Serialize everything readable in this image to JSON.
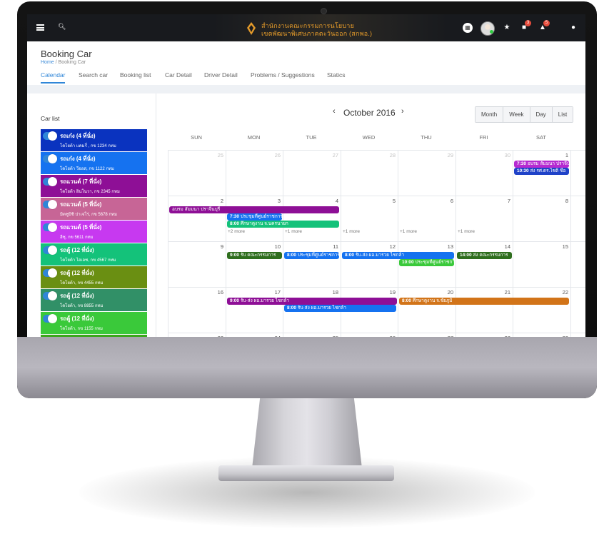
{
  "topbar": {
    "logo_line1": "สำนักงานคณะกรรมการนโยบาย",
    "logo_line2": "เขตพัฒนาพิเศษภาคตะวันออก (สกพอ.)",
    "badge_messages": "3",
    "badge_notifications": "5"
  },
  "header": {
    "title": "Booking Car",
    "breadcrumb_home": "Home",
    "breadcrumb_sep": "/",
    "breadcrumb_current": "Booking Car"
  },
  "tabs": [
    "Calendar",
    "Search car",
    "Booking list",
    "Car Detail",
    "Driver Detail",
    "Problems / Suggestions",
    "Statics"
  ],
  "sidebar": {
    "title": "Car list",
    "cars": [
      {
        "name": "รถเก๋ง (4 ที่นั่ง)",
        "detail": "โตโยต้า แคมรี่ , กข 1234 กทม",
        "color": "#0a33bf"
      },
      {
        "name": "รถเก๋ง (4 ที่นั่ง)",
        "detail": "โตโยต้า วีออส, กข 1122 กทม",
        "color": "#1572f0"
      },
      {
        "name": "รถแวนด์ (7 ที่นั่ง)",
        "detail": "โตโยต้า อินโนวา, กข 2345 กทม",
        "color": "#8e0f96"
      },
      {
        "name": "รถแวนด์ (5 ที่นั่ง)",
        "detail": "มิตซูบิชิ ปาเจโร่, กข 5678 กทม",
        "color": "#c76596"
      },
      {
        "name": "รถแวนด์ (5 ที่นั่ง)",
        "detail": "ฮีซุ, กข 5611 กทม",
        "color": "#c739f0"
      },
      {
        "name": "รถตู้ (12 ที่นั่ง)",
        "detail": "โตโยต้า ไฮเอซ, กข 4567 กทม",
        "color": "#14c27a"
      },
      {
        "name": "รถตู้ (12 ที่นั่ง)",
        "detail": "โตโยต้า, กข 4455 กทม",
        "color": "#6a8f12"
      },
      {
        "name": "รถตู้ (12 ที่นั่ง)",
        "detail": "โตโยต้า, กข 8855 กทม",
        "color": "#319067"
      },
      {
        "name": "รถตู้ (12 ที่นั่ง)",
        "detail": "โตโยต้า, กข 1155 กทม",
        "color": "#3ac93a"
      },
      {
        "name": "",
        "detail": "",
        "color": "#3aa61c"
      }
    ]
  },
  "calendar": {
    "month_title": "October 2016",
    "prev_icon": "chevron-left-icon",
    "next_icon": "chevron-right-icon",
    "views": [
      "Month",
      "Week",
      "Day",
      "List"
    ],
    "weekdays": [
      "SUN",
      "MON",
      "TUE",
      "WED",
      "THU",
      "FRI",
      "SAT"
    ],
    "weeks": [
      [
        {
          "d": "25",
          "o": true
        },
        {
          "d": "26",
          "o": true
        },
        {
          "d": "27",
          "o": true
        },
        {
          "d": "28",
          "o": true
        },
        {
          "d": "29",
          "o": true
        },
        {
          "d": "30",
          "o": true
        },
        {
          "d": "1"
        }
      ],
      [
        {
          "d": "2"
        },
        {
          "d": "3"
        },
        {
          "d": "4"
        },
        {
          "d": "5"
        },
        {
          "d": "6"
        },
        {
          "d": "7"
        },
        {
          "d": "8"
        }
      ],
      [
        {
          "d": "9"
        },
        {
          "d": "10"
        },
        {
          "d": "11"
        },
        {
          "d": "12"
        },
        {
          "d": "13"
        },
        {
          "d": "14"
        },
        {
          "d": "15"
        }
      ],
      [
        {
          "d": "16"
        },
        {
          "d": "17"
        },
        {
          "d": "18"
        },
        {
          "d": "19"
        },
        {
          "d": "20"
        },
        {
          "d": "21"
        },
        {
          "d": "22"
        }
      ],
      [
        {
          "d": "23"
        },
        {
          "d": "24"
        },
        {
          "d": "25"
        },
        {
          "d": "26"
        },
        {
          "d": "27"
        },
        {
          "d": "28"
        },
        {
          "d": "29"
        }
      ]
    ],
    "events": [
      {
        "week": 0,
        "start": 6,
        "span": 1,
        "row": 0,
        "time": "7:30",
        "title": "อบรม สัมมนา ปราจีนบุรี",
        "color": "#b62ad0"
      },
      {
        "week": 0,
        "start": 6,
        "span": 1,
        "row": 1,
        "time": "10:30",
        "title": "ส่ง รศ.ดร.ไชติ ชื่อ",
        "color": "#1f42c8"
      },
      {
        "week": 1,
        "start": 0,
        "span": 3,
        "row": 0,
        "time": "",
        "title": "อบรม สัมมนา ปราจีนบุรี",
        "color": "#8e0f96"
      },
      {
        "week": 1,
        "start": 1,
        "span": 1,
        "row": 1,
        "time": "7:30",
        "title": "ประชุมที่ศูนย์ราชการ",
        "color": "#1572f0"
      },
      {
        "week": 1,
        "start": 1,
        "span": 2,
        "row": 2,
        "time": "8:00",
        "title": "ศึกษาดูงาน จ.นครนายก",
        "color": "#14c27a"
      },
      {
        "week": 2,
        "start": 1,
        "span": 1,
        "row": 0,
        "time": "9:00",
        "title": "รับ คณะกรรมการ",
        "color": "#2f6e1e"
      },
      {
        "week": 2,
        "start": 2,
        "span": 1,
        "row": 0,
        "time": "8:00",
        "title": "ประชุมที่ศูนย์ราชการ",
        "color": "#1572f0"
      },
      {
        "week": 2,
        "start": 3,
        "span": 2,
        "row": 0,
        "time": "8:00",
        "title": "รับ-ส่ง ผอ.มารวย ไชกล้า",
        "color": "#1572f0"
      },
      {
        "week": 2,
        "start": 4,
        "span": 1,
        "row": 1,
        "time": "10:00",
        "title": "ประชุมที่ศูนย์ราชการ",
        "color": "#3ac93a"
      },
      {
        "week": 2,
        "start": 5,
        "span": 1,
        "row": 0,
        "time": "14:00",
        "title": "ส่ง คณะกรรมการ",
        "color": "#2f6e1e"
      },
      {
        "week": 3,
        "start": 1,
        "span": 3,
        "row": 0,
        "time": "9:00",
        "title": "รับ-ส่ง ผอ.มารวย ไชกล้า",
        "color": "#8e0f96"
      },
      {
        "week": 3,
        "start": 2,
        "span": 2,
        "row": 1,
        "time": "8:00",
        "title": "รับ-ส่ง ผอ.มารวย ไชกล้า",
        "color": "#1572f0"
      },
      {
        "week": 3,
        "start": 4,
        "span": 3,
        "row": 0,
        "time": "8:00",
        "title": "ศึกษาดูงาน จ.ชัยภูมิ",
        "color": "#d27419"
      }
    ],
    "more_links": [
      {
        "week": 1,
        "col": 1,
        "text": "+2 more"
      },
      {
        "week": 1,
        "col": 2,
        "text": "+1 more"
      },
      {
        "week": 1,
        "col": 3,
        "text": "+1 more"
      },
      {
        "week": 1,
        "col": 4,
        "text": "+1 more"
      },
      {
        "week": 1,
        "col": 5,
        "text": "+1 more"
      }
    ]
  }
}
